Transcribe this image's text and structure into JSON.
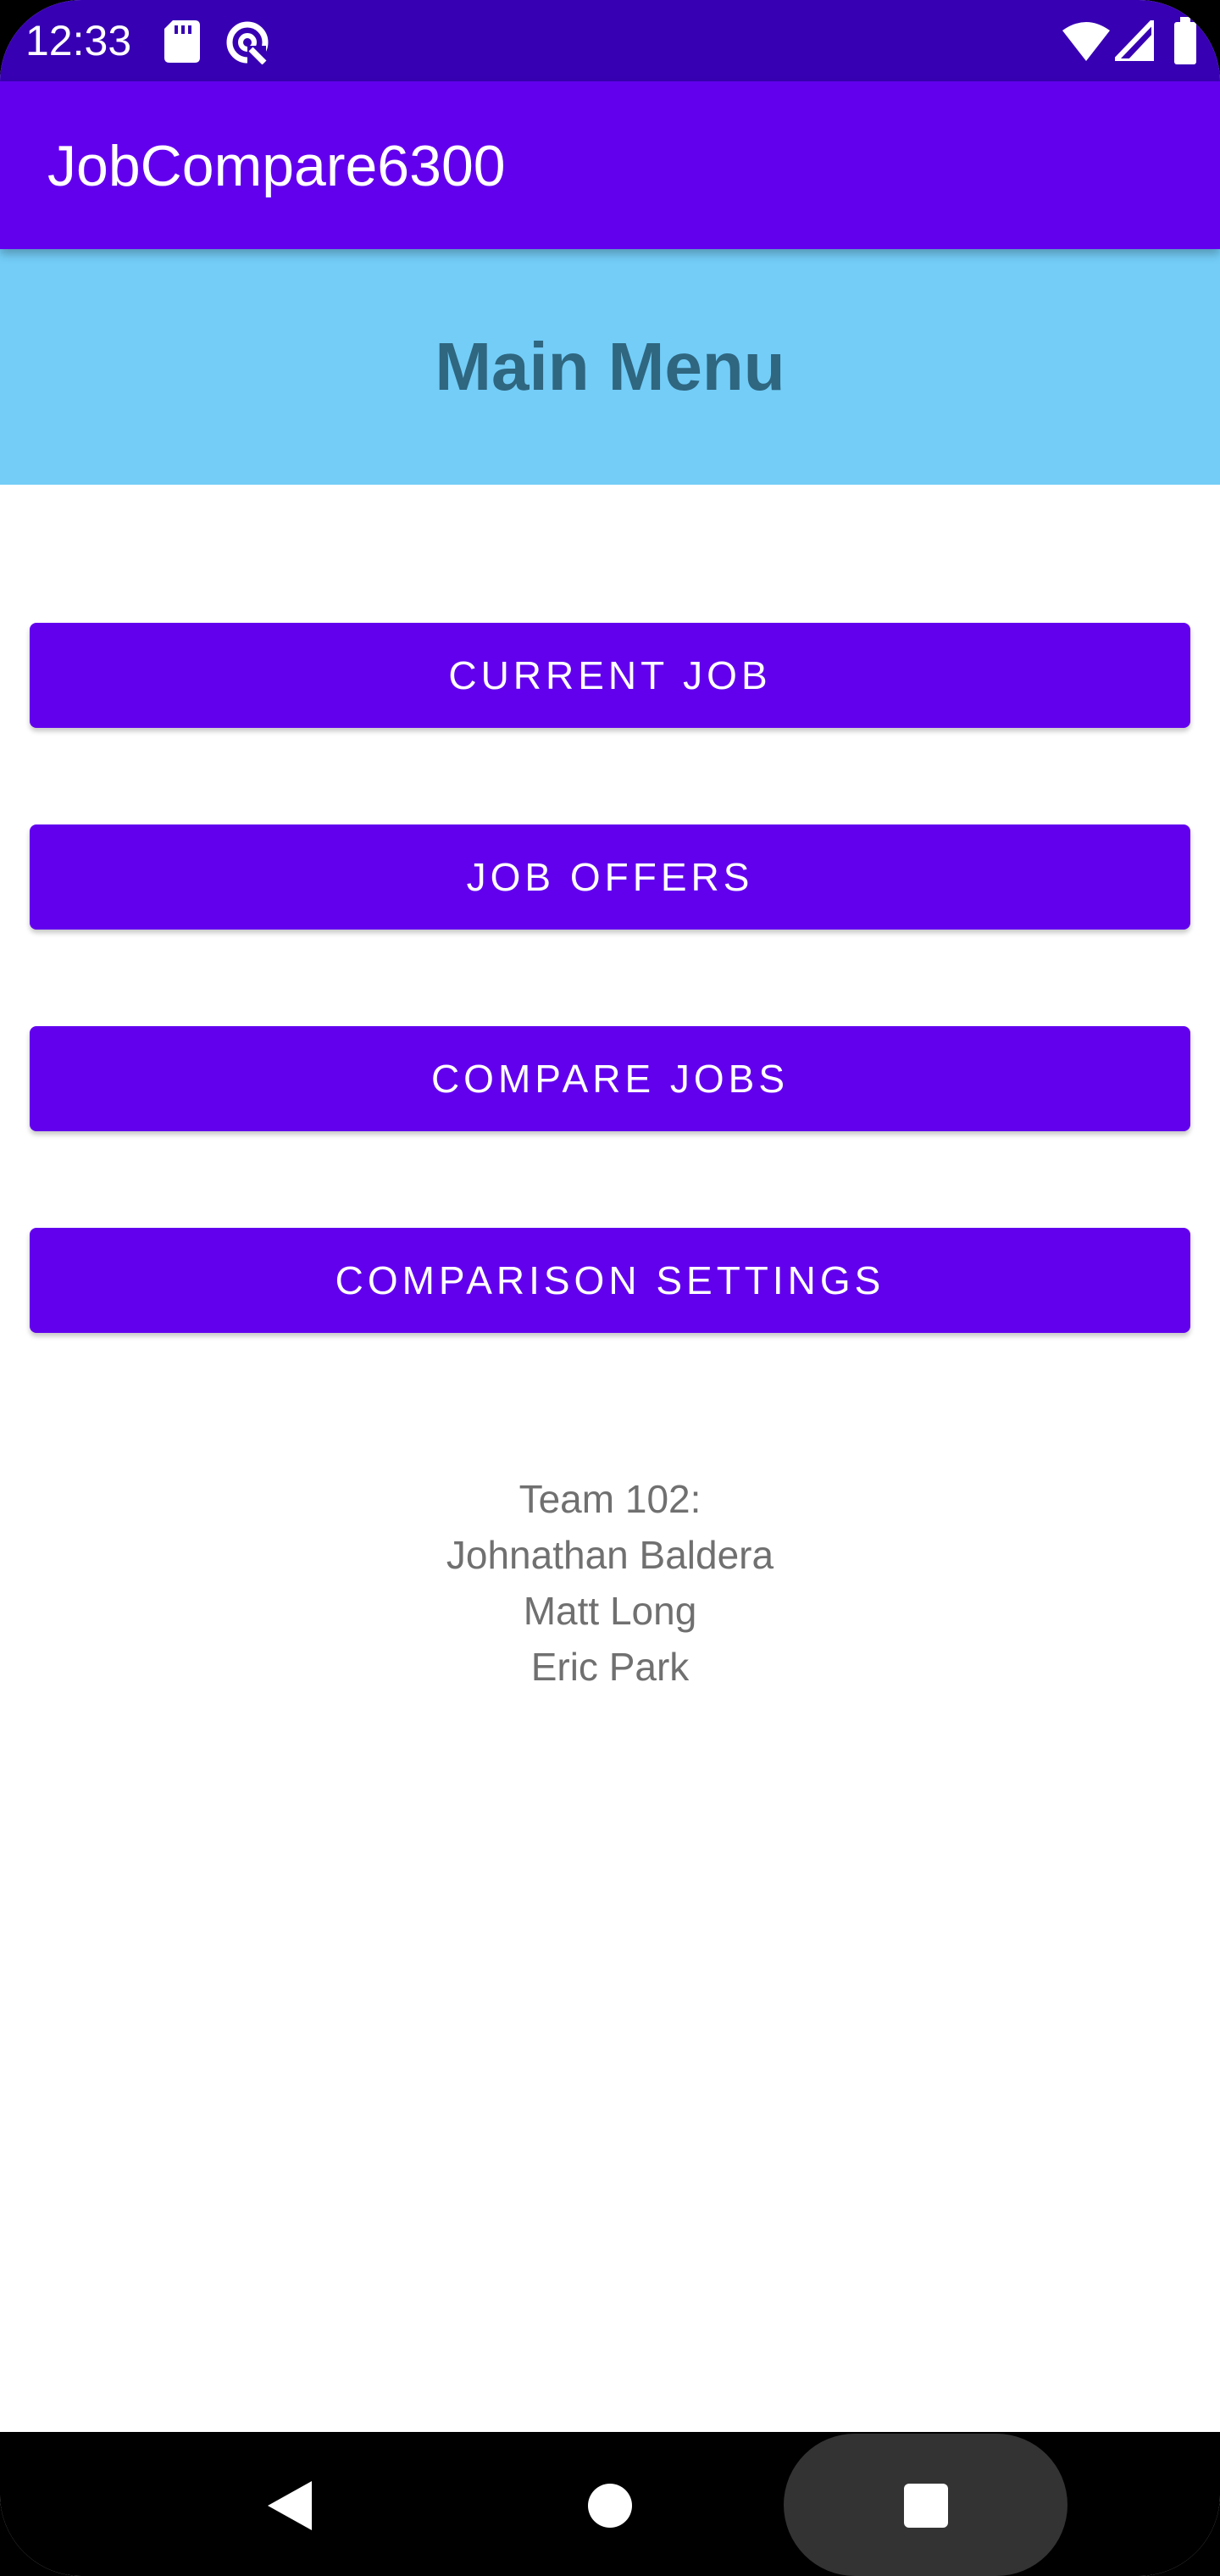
{
  "status_bar": {
    "time": "12:33",
    "icons": [
      "sd-card-icon",
      "data-saver-icon",
      "wifi-icon",
      "cell-signal-icon",
      "battery-icon"
    ]
  },
  "app_bar": {
    "title": "JobCompare6300",
    "color": "#6200EE"
  },
  "header": {
    "title": "Main Menu",
    "background": "#73CDF7"
  },
  "buttons": {
    "current_job": "CURRENT JOB",
    "job_offers": "JOB OFFERS",
    "compare_jobs": "COMPARE JOBS",
    "comparison_settings": "COMPARISON SETTINGS"
  },
  "team": {
    "heading": "Team 102:",
    "members": [
      "Johnathan Baldera",
      "Matt Long",
      "Eric Park"
    ]
  },
  "nav_bar": {
    "icons": [
      "back-icon",
      "home-icon",
      "recents-icon"
    ]
  }
}
